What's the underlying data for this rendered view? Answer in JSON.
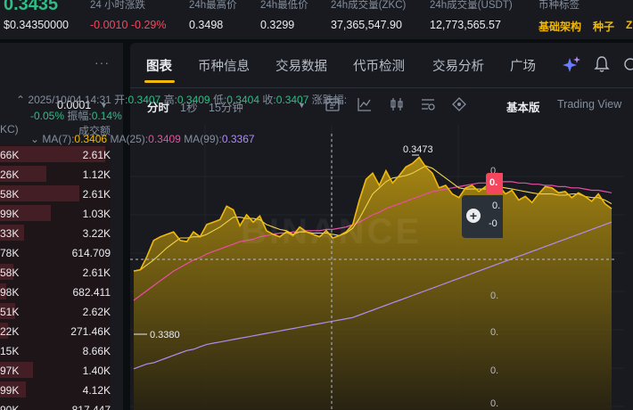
{
  "ticker": {
    "price": "0.3435",
    "usd_price": "$0.34350000",
    "change_label": "24 小时涨跌",
    "change_value": "-0.0010 -0.29%",
    "high_label": "24h最高价",
    "high_value": "0.3498",
    "low_label": "24h最低价",
    "low_value": "0.3299",
    "vol_base_label": "24h成交量(ZKC)",
    "vol_base_value": "37,365,547.90",
    "vol_quote_label": "24h成交量(USDT)",
    "vol_quote_value": "12,773,565.57",
    "tags_label": "币种标签",
    "tag_1": "基础架构",
    "tag_2": "种子",
    "tag_3": "Z"
  },
  "orderbook": {
    "more": "···",
    "precision": "0.0001",
    "col_price": "KC)",
    "col_total": "成交额",
    "rows": [
      {
        "p": "66K",
        "v": "2.61K",
        "depth": 0.95
      },
      {
        "p": "26K",
        "v": "1.12K",
        "depth": 0.42
      },
      {
        "p": "58K",
        "v": "2.61K",
        "depth": 0.72
      },
      {
        "p": "99K",
        "v": "1.03K",
        "depth": 0.46
      },
      {
        "p": "33K",
        "v": "3.22K",
        "depth": 0.22
      },
      {
        "p": "78K",
        "v": "614.709",
        "depth": 0.0
      },
      {
        "p": "58K",
        "v": "2.61K",
        "depth": 0.12
      },
      {
        "p": "98K",
        "v": "682.411",
        "depth": 0.06
      },
      {
        "p": "51K",
        "v": "2.62K",
        "depth": 0.14
      },
      {
        "p": "22K",
        "v": "271.46K",
        "depth": 0.07
      },
      {
        "p": "15K",
        "v": "8.66K",
        "depth": 0.0
      },
      {
        "p": "97K",
        "v": "1.40K",
        "depth": 0.3
      },
      {
        "p": "99K",
        "v": "4.12K",
        "depth": 0.23
      },
      {
        "p": "90K",
        "v": "817.447",
        "depth": 0.0
      }
    ]
  },
  "tabs": [
    "图表",
    "币种信息",
    "交易数据",
    "代币检测",
    "交易分析",
    "广场"
  ],
  "toolbar": {
    "time": "分时",
    "s1": "1秒",
    "m15": "15分钟",
    "basic": "基本版",
    "tv": "Trading View"
  },
  "legend": {
    "datetime": "2025/10/04 14:31",
    "open_label": "开:",
    "open": "0.3407",
    "high_label": "高:",
    "high": "0.3409",
    "low_label": "低:",
    "low": "0.3404",
    "close_label": "收:",
    "close": "0.3407",
    "chg_label": "涨跌幅:",
    "chg": "-0.05%",
    "amp_label": "振幅:",
    "amp": "0.14%",
    "ma7_label": "MA(7):",
    "ma7": "0.3406",
    "ma25_label": "MA(25):",
    "ma25": "0.3409",
    "ma99_label": "MA(99):",
    "ma99": "0.3367"
  },
  "annotations": {
    "high": "0.3473",
    "low": "0.3380"
  },
  "watermark": "BINANCE",
  "axis": {
    "last_tag": "0.",
    "tip_1": "0.",
    "tip_2": "-0",
    "y_ticks": [
      "0.",
      "0.",
      "0.",
      "0.",
      "0."
    ]
  },
  "colors": {
    "up": "#2ebd85",
    "down": "#f6465d",
    "accent": "#f0b90b",
    "ma7": "#f0b90b",
    "ma25": "#e84fa2",
    "ma99": "#b18cf0"
  },
  "chart_data": {
    "type": "area",
    "title": "",
    "y_domain": [
      0.327,
      0.3485
    ],
    "price": [
      0.338,
      0.3381,
      0.3392,
      0.3405,
      0.3408,
      0.341,
      0.3412,
      0.3405,
      0.3404,
      0.3412,
      0.3408,
      0.3418,
      0.342,
      0.3422,
      0.3433,
      0.343,
      0.3417,
      0.3426,
      0.342,
      0.3425,
      0.3413,
      0.341,
      0.3408,
      0.3412,
      0.3409,
      0.3416,
      0.3412,
      0.341,
      0.3408,
      0.3413,
      0.3407,
      0.3409,
      0.3412,
      0.3418,
      0.3438,
      0.3455,
      0.346,
      0.345,
      0.3462,
      0.3452,
      0.3458,
      0.3465,
      0.3468,
      0.3473,
      0.3465,
      0.346,
      0.3448,
      0.345,
      0.3443,
      0.344,
      0.3448,
      0.345,
      0.3445,
      0.3449,
      0.3452,
      0.345,
      0.3443,
      0.3446,
      0.3438,
      0.3441,
      0.3436,
      0.3443,
      0.3449,
      0.3448,
      0.3444,
      0.3445,
      0.344,
      0.3444,
      0.3441,
      0.3437,
      0.3443,
      0.3435,
      0.3431
    ],
    "ma7": [
      0.338,
      0.3381,
      0.3385,
      0.3389,
      0.3394,
      0.3399,
      0.3403,
      0.3407,
      0.3407,
      0.3408,
      0.3408,
      0.341,
      0.3413,
      0.3416,
      0.342,
      0.3424,
      0.3424,
      0.3423,
      0.3423,
      0.3422,
      0.3418,
      0.3416,
      0.3414,
      0.3413,
      0.341,
      0.3412,
      0.3412,
      0.3411,
      0.3411,
      0.3411,
      0.341,
      0.3409,
      0.3411,
      0.3415,
      0.3423,
      0.3433,
      0.3443,
      0.3448,
      0.3453,
      0.3456,
      0.3457,
      0.3458,
      0.346,
      0.3463,
      0.3466,
      0.3464,
      0.346,
      0.3456,
      0.3452,
      0.3448,
      0.3447,
      0.3447,
      0.3447,
      0.3447,
      0.3448,
      0.3449,
      0.3448,
      0.3447,
      0.3446,
      0.3445,
      0.3444,
      0.3443,
      0.3443,
      0.3443,
      0.3442,
      0.3442,
      0.3443,
      0.3443,
      0.3441,
      0.344,
      0.344,
      0.3438,
      0.3435
    ],
    "ma25": [
      0.3356,
      0.336,
      0.3364,
      0.3368,
      0.3372,
      0.3376,
      0.338,
      0.3383,
      0.3386,
      0.3389,
      0.3391,
      0.3394,
      0.3396,
      0.3398,
      0.34,
      0.3402,
      0.3404,
      0.3405,
      0.3406,
      0.3408,
      0.3409,
      0.341,
      0.3411,
      0.3411,
      0.3412,
      0.3412,
      0.3413,
      0.3413,
      0.3413,
      0.3414,
      0.3414,
      0.3415,
      0.3416,
      0.3418,
      0.342,
      0.3423,
      0.3426,
      0.3428,
      0.3431,
      0.3433,
      0.3435,
      0.3437,
      0.3439,
      0.3441,
      0.3443,
      0.3445,
      0.3446,
      0.3447,
      0.3448,
      0.3449,
      0.345,
      0.3451,
      0.3452,
      0.3452,
      0.3453,
      0.3453,
      0.3453,
      0.3453,
      0.3452,
      0.3452,
      0.3451,
      0.3451,
      0.345,
      0.345,
      0.3449,
      0.3449,
      0.3448,
      0.3448,
      0.3447,
      0.3446,
      0.3446,
      0.3445,
      0.3444
    ],
    "ma99": [
      0.33,
      0.3302,
      0.3304,
      0.3305,
      0.3307,
      0.3309,
      0.3311,
      0.3313,
      0.3315,
      0.3316,
      0.3318,
      0.332,
      0.3321,
      0.3322,
      0.3323,
      0.3324,
      0.3325,
      0.3326,
      0.3327,
      0.3328,
      0.3329,
      0.333,
      0.3331,
      0.3332,
      0.3333,
      0.3334,
      0.3335,
      0.3336,
      0.3337,
      0.3338,
      0.3339,
      0.334,
      0.3341,
      0.3342,
      0.3344,
      0.3346,
      0.3348,
      0.335,
      0.3352,
      0.3354,
      0.3356,
      0.3358,
      0.336,
      0.3362,
      0.3364,
      0.3366,
      0.3368,
      0.337,
      0.3372,
      0.3374,
      0.3376,
      0.3378,
      0.338,
      0.3382,
      0.3384,
      0.3386,
      0.3388,
      0.339,
      0.3392,
      0.3394,
      0.3396,
      0.3398,
      0.34,
      0.3402,
      0.3404,
      0.3406,
      0.3408,
      0.341,
      0.3412,
      0.3414,
      0.3416,
      0.3418,
      0.342
    ]
  }
}
